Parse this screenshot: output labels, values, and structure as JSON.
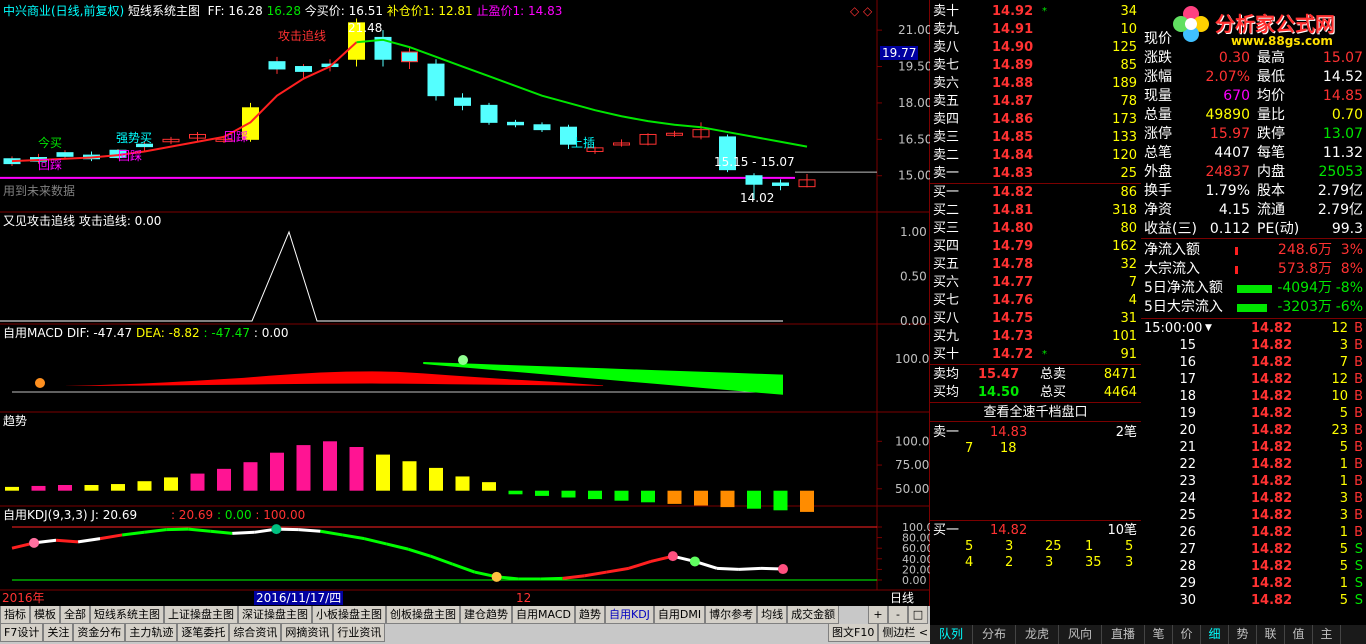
{
  "header": {
    "stock": "中兴商业(日线,前复权)",
    "indicator": "短线系统主图",
    "ff": "FF: 16.28",
    "ff2": "16.28",
    "buy_price": "今买价: 16.51",
    "add_price": "补仓价1: 12.81",
    "target_price": "止盈价1: 14.83",
    "diamond": "◇ ◇"
  },
  "main_annotations": {
    "attack": "攻击追线",
    "high": "21.48",
    "high_box": "19.77",
    "buy_signal": "今买",
    "strong_buy": "强势买",
    "pullback1": "回踩",
    "pullback2": "回踩",
    "pullback3": "回踩",
    "up": "上插",
    "range": "15.15 - 15.07",
    "low": "14.02",
    "future": "用到未来数据"
  },
  "panels": {
    "attack_line": "又见攻击追线  攻击追线: 0.00",
    "macd_name": "自用MACD",
    "macd_dif": "DIF: -47.47",
    "macd_dea": "DEA: -8.82",
    "macd_val": ": -47.47",
    "macd_zero": ": 0.00",
    "trend": "趋势",
    "kdj_name": "自用KDJ(9,3,3)",
    "kdj_j": "J: 20.69",
    "kdj_v1": ": 20.69",
    "kdj_v2": ": 0.00",
    "kdj_v3": ": 100.00"
  },
  "axis_labels": {
    "main": [
      "21.00",
      "19.50",
      "18.00",
      "16.50",
      "15.00"
    ],
    "attack": [
      "1.00",
      "0.50",
      "0.00"
    ],
    "macd": [
      "100.0"
    ],
    "trend": [
      "100.0",
      "75.00",
      "50.00"
    ],
    "kdj": [
      "100.00",
      "80.00",
      "60.00",
      "40.00",
      "20.00",
      "0.00"
    ]
  },
  "date_bar": {
    "year": "2016年",
    "date": "2016/11/17/四",
    "month": "12",
    "period": "日线"
  },
  "tabs_row1": [
    "指标",
    "模板",
    "全部",
    "短线系统主图",
    "上证操盘主图",
    "深证操盘主图",
    "小板操盘主图",
    "创板操盘主图",
    "建仓趋势",
    "自用MACD",
    "趋势",
    "自用KDJ",
    "自用DMI",
    "博尔参考",
    "均线",
    "成交金额"
  ],
  "tabs_row2": [
    "F7设计",
    "关注",
    "资金分布",
    "主力轨迹",
    "逐笔委托",
    "综合资讯",
    "网摘资讯",
    "行业资讯"
  ],
  "tabs_row2_right": [
    "图文F10",
    "侧边栏 <"
  ],
  "zoom_controls": [
    "+",
    "-",
    "□"
  ],
  "order_book": {
    "sell": [
      {
        "label": "卖十",
        "price": "14.92",
        "mark": "*",
        "vol": "34"
      },
      {
        "label": "卖九",
        "price": "14.91",
        "mark": "",
        "vol": "10"
      },
      {
        "label": "卖八",
        "price": "14.90",
        "mark": "",
        "vol": "125"
      },
      {
        "label": "卖七",
        "price": "14.89",
        "mark": "",
        "vol": "85"
      },
      {
        "label": "卖六",
        "price": "14.88",
        "mark": "",
        "vol": "189"
      },
      {
        "label": "卖五",
        "price": "14.87",
        "mark": "",
        "vol": "78"
      },
      {
        "label": "卖四",
        "price": "14.86",
        "mark": "",
        "vol": "173"
      },
      {
        "label": "卖三",
        "price": "14.85",
        "mark": "",
        "vol": "133"
      },
      {
        "label": "卖二",
        "price": "14.84",
        "mark": "",
        "vol": "120"
      },
      {
        "label": "卖一",
        "price": "14.83",
        "mark": "",
        "vol": "25"
      }
    ],
    "buy": [
      {
        "label": "买一",
        "price": "14.82",
        "mark": "",
        "vol": "86"
      },
      {
        "label": "买二",
        "price": "14.81",
        "mark": "",
        "vol": "318"
      },
      {
        "label": "买三",
        "price": "14.80",
        "mark": "",
        "vol": "80"
      },
      {
        "label": "买四",
        "price": "14.79",
        "mark": "",
        "vol": "162"
      },
      {
        "label": "买五",
        "price": "14.78",
        "mark": "",
        "vol": "32"
      },
      {
        "label": "买六",
        "price": "14.77",
        "mark": "",
        "vol": "7"
      },
      {
        "label": "买七",
        "price": "14.76",
        "mark": "",
        "vol": "4"
      },
      {
        "label": "买八",
        "price": "14.75",
        "mark": "",
        "vol": "31"
      },
      {
        "label": "买九",
        "price": "14.73",
        "mark": "",
        "vol": "101"
      },
      {
        "label": "买十",
        "price": "14.72",
        "mark": "*",
        "vol": "91"
      }
    ],
    "avg_sell": {
      "label": "卖均",
      "price": "15.47",
      "total_label": "总卖",
      "total": "8471"
    },
    "avg_buy": {
      "label": "买均",
      "price": "14.50",
      "total_label": "总买",
      "total": "4464"
    },
    "thousand_btn": "查看全速千档盘口",
    "sell1_detail": {
      "label": "卖一",
      "price": "14.83",
      "count": "2笔",
      "orders": [
        "7",
        "18"
      ]
    },
    "buy1_detail": {
      "label": "买一",
      "price": "14.82",
      "count": "10笔",
      "orders_row1": [
        "5",
        "3",
        "25",
        "1",
        "5"
      ],
      "orders_row2": [
        "4",
        "2",
        "3",
        "35",
        "3"
      ]
    }
  },
  "logo": {
    "title": "分析家公式网",
    "url": "www.88gs.com"
  },
  "stats": [
    {
      "l1": "现价",
      "v1": "",
      "l2": "",
      "v2": "",
      "c1": "white",
      "c2": "white"
    },
    {
      "l1": "涨跌",
      "v1": "0.30",
      "l2": "最高",
      "v2": "15.07",
      "c1": "red",
      "c2": "red"
    },
    {
      "l1": "涨幅",
      "v1": "2.07%",
      "l2": "最低",
      "v2": "14.52",
      "c1": "red",
      "c2": "white"
    },
    {
      "l1": "现量",
      "v1": "670",
      "l2": "均价",
      "v2": "14.85",
      "c1": "mag",
      "c2": "red"
    },
    {
      "l1": "总量",
      "v1": "49890",
      "l2": "量比",
      "v2": "0.70",
      "c1": "yellow",
      "c2": "yellow"
    },
    {
      "l1": "涨停",
      "v1": "15.97",
      "l2": "跌停",
      "v2": "13.07",
      "c1": "red",
      "c2": "green"
    },
    {
      "l1": "总笔",
      "v1": "4407",
      "l2": "每笔",
      "v2": "11.32",
      "c1": "white",
      "c2": "white"
    },
    {
      "l1": "外盘",
      "v1": "24837",
      "l2": "内盘",
      "v2": "25053",
      "c1": "red",
      "c2": "green"
    },
    {
      "l1": "换手",
      "v1": "1.79%",
      "l2": "股本",
      "v2": "2.79亿",
      "c1": "white",
      "c2": "white"
    },
    {
      "l1": "净资",
      "v1": "4.15",
      "l2": "流通",
      "v2": "2.79亿",
      "c1": "white",
      "c2": "white"
    },
    {
      "l1": "收益(三)",
      "v1": "0.112",
      "l2": "PE(动)",
      "v2": "99.3",
      "c1": "white",
      "c2": "white"
    }
  ],
  "flows": [
    {
      "label": "净流入额",
      "value": "248.6万",
      "pct": "3%",
      "color": "red",
      "bar": 0.03
    },
    {
      "label": "大宗流入",
      "value": "573.8万",
      "pct": "8%",
      "color": "red",
      "bar": 0.03
    },
    {
      "label": "5日净流入额",
      "value": "-4094万",
      "pct": "-8%",
      "color": "green",
      "bar": 0.35
    },
    {
      "label": "5日大宗流入",
      "value": "-3203万",
      "pct": "-6%",
      "color": "green",
      "bar": 0.3
    }
  ],
  "ticks": [
    {
      "t": "15:00:00",
      "arrow": "▼",
      "p": "14.82",
      "v": "12",
      "s": "B"
    },
    {
      "t": "15",
      "p": "14.82",
      "v": "3",
      "s": "B"
    },
    {
      "t": "16",
      "p": "14.82",
      "v": "7",
      "s": "B"
    },
    {
      "t": "17",
      "p": "14.82",
      "v": "12",
      "s": "B"
    },
    {
      "t": "18",
      "p": "14.82",
      "v": "10",
      "s": "B"
    },
    {
      "t": "19",
      "p": "14.82",
      "v": "5",
      "s": "B"
    },
    {
      "t": "20",
      "p": "14.82",
      "v": "23",
      "s": "B"
    },
    {
      "t": "21",
      "p": "14.82",
      "v": "5",
      "s": "B"
    },
    {
      "t": "22",
      "p": "14.82",
      "v": "1",
      "s": "B"
    },
    {
      "t": "23",
      "p": "14.82",
      "v": "1",
      "s": "B"
    },
    {
      "t": "24",
      "p": "14.82",
      "v": "3",
      "s": "B"
    },
    {
      "t": "25",
      "p": "14.82",
      "v": "3",
      "s": "B"
    },
    {
      "t": "26",
      "p": "14.82",
      "v": "1",
      "s": "B"
    },
    {
      "t": "27",
      "p": "14.82",
      "v": "5",
      "s": "S"
    },
    {
      "t": "28",
      "p": "14.82",
      "v": "5",
      "s": "S"
    },
    {
      "t": "29",
      "p": "14.82",
      "v": "1",
      "s": "S"
    },
    {
      "t": "30",
      "p": "14.82",
      "v": "5",
      "s": "S"
    }
  ],
  "right_tabs": [
    "队列",
    "分布",
    "龙虎",
    "风向",
    "直播",
    "笔",
    "价",
    "细",
    "势",
    "联",
    "值",
    "主"
  ],
  "colors": {
    "up": "#ff3232",
    "down": "#54ffff",
    "line_green": "#00e600",
    "grid": "#7b0000",
    "magenta": "#ff00ff"
  },
  "chart_data": {
    "type": "candlestick",
    "candles": [
      {
        "o": 15.5,
        "c": 15.7,
        "h": 15.8,
        "l": 15.4,
        "up": true
      },
      {
        "o": 15.6,
        "c": 15.75,
        "h": 15.9,
        "l": 15.5,
        "up": true
      },
      {
        "o": 15.8,
        "c": 15.95,
        "h": 16.05,
        "l": 15.7,
        "up": true
      },
      {
        "o": 15.85,
        "c": 15.7,
        "h": 16.0,
        "l": 15.6,
        "up": false
      },
      {
        "o": 15.75,
        "c": 16.05,
        "h": 16.1,
        "l": 15.7,
        "up": true
      },
      {
        "o": 16.2,
        "c": 16.3,
        "h": 16.4,
        "l": 16.0,
        "up": true
      },
      {
        "o": 16.4,
        "c": 16.5,
        "h": 16.6,
        "l": 16.3,
        "up": true
      },
      {
        "o": 16.55,
        "c": 16.7,
        "h": 16.8,
        "l": 16.4,
        "up": true
      },
      {
        "o": 16.5,
        "c": 16.5,
        "h": 16.65,
        "l": 16.35,
        "up": true
      },
      {
        "o": 16.5,
        "c": 17.8,
        "h": 18.0,
        "l": 16.4,
        "up": true
      },
      {
        "o": 19.4,
        "c": 19.7,
        "h": 19.9,
        "l": 19.2,
        "up": true
      },
      {
        "o": 19.3,
        "c": 19.5,
        "h": 19.6,
        "l": 19.0,
        "up": true
      },
      {
        "o": 19.5,
        "c": 19.6,
        "h": 19.8,
        "l": 19.3,
        "up": true
      },
      {
        "o": 19.8,
        "c": 21.3,
        "h": 21.48,
        "l": 19.5,
        "up": true
      },
      {
        "o": 20.7,
        "c": 19.8,
        "h": 21.0,
        "l": 19.5,
        "up": false
      },
      {
        "o": 19.7,
        "c": 20.1,
        "h": 20.3,
        "l": 19.4,
        "up": true
      },
      {
        "o": 19.6,
        "c": 18.3,
        "h": 19.8,
        "l": 18.1,
        "up": false
      },
      {
        "o": 18.2,
        "c": 17.9,
        "h": 18.4,
        "l": 17.7,
        "up": false
      },
      {
        "o": 17.9,
        "c": 17.2,
        "h": 18.0,
        "l": 17.1,
        "up": false
      },
      {
        "o": 17.2,
        "c": 17.1,
        "h": 17.3,
        "l": 17.0,
        "up": false
      },
      {
        "o": 17.1,
        "c": 16.9,
        "h": 17.2,
        "l": 16.8,
        "up": false
      },
      {
        "o": 17.0,
        "c": 16.3,
        "h": 17.1,
        "l": 16.1,
        "up": false
      },
      {
        "o": 16.0,
        "c": 16.15,
        "h": 16.2,
        "l": 15.9,
        "up": true
      },
      {
        "o": 16.3,
        "c": 16.35,
        "h": 16.5,
        "l": 16.2,
        "up": true
      },
      {
        "o": 16.3,
        "c": 16.7,
        "h": 16.75,
        "l": 16.25,
        "up": true
      },
      {
        "o": 16.7,
        "c": 16.75,
        "h": 16.85,
        "l": 16.6,
        "up": true
      },
      {
        "o": 16.6,
        "c": 16.9,
        "h": 17.2,
        "l": 16.5,
        "up": true
      },
      {
        "o": 16.6,
        "c": 15.25,
        "h": 16.7,
        "l": 15.15,
        "up": false
      },
      {
        "o": 15.0,
        "c": 14.65,
        "h": 15.1,
        "l": 14.02,
        "up": false
      },
      {
        "o": 14.7,
        "c": 14.6,
        "h": 14.85,
        "l": 14.4,
        "up": false
      },
      {
        "o": 14.55,
        "c": 14.83,
        "h": 15.07,
        "l": 14.52,
        "up": true
      }
    ],
    "ma": [
      15.6,
      15.65,
      15.7,
      15.75,
      15.85,
      16.0,
      16.2,
      16.4,
      16.6,
      17.2,
      18.3,
      19.0,
      19.5,
      20.5,
      20.6,
      20.3,
      19.9,
      19.5,
      19.1,
      18.7,
      18.3,
      18.0,
      17.7,
      17.45,
      17.25,
      17.1,
      17.0,
      16.8,
      16.6,
      16.4,
      16.2
    ],
    "ma_red_until": 13,
    "attack": [
      0,
      0,
      0,
      0,
      0,
      0,
      0,
      0,
      0,
      0,
      0,
      0,
      0,
      0,
      0,
      0,
      0,
      0,
      0,
      0,
      0,
      0,
      0,
      0,
      0,
      0,
      0,
      0,
      0,
      0,
      0
    ],
    "attack_peak_index": 10,
    "macd_dif": [
      -5,
      -3,
      0,
      5,
      12,
      20,
      30,
      42,
      55,
      68,
      85,
      100,
      112,
      120,
      122,
      118,
      105,
      90,
      75,
      60,
      48,
      35,
      20,
      5,
      -10,
      -20,
      -30,
      -38,
      -44,
      -47,
      -47.47
    ],
    "trend_values": [
      52,
      53,
      54,
      54,
      55,
      58,
      62,
      66,
      71,
      78,
      88,
      96,
      100,
      94,
      86,
      79,
      72,
      63,
      57,
      52,
      47,
      41,
      37,
      34,
      32,
      32,
      32,
      32,
      32,
      32,
      32
    ],
    "trend_colors": [
      "y",
      "m",
      "m",
      "y",
      "y",
      "y",
      "y",
      "m",
      "m",
      "m",
      "m",
      "m",
      "m",
      "m",
      "y",
      "y",
      "y",
      "y",
      "y",
      "g",
      "g",
      "g",
      "g",
      "g",
      "g",
      "o",
      "o",
      "o",
      "g",
      "g",
      "o"
    ],
    "kdj": [
      60,
      70,
      75,
      72,
      78,
      85,
      90,
      95,
      96,
      92,
      88,
      90,
      96,
      95,
      92,
      85,
      78,
      68,
      58,
      45,
      30,
      15,
      6,
      2,
      2,
      3,
      8,
      15,
      22,
      35,
      45,
      35,
      22,
      20,
      22,
      20.69
    ],
    "ylim_main": [
      14.0,
      21.5
    ]
  }
}
